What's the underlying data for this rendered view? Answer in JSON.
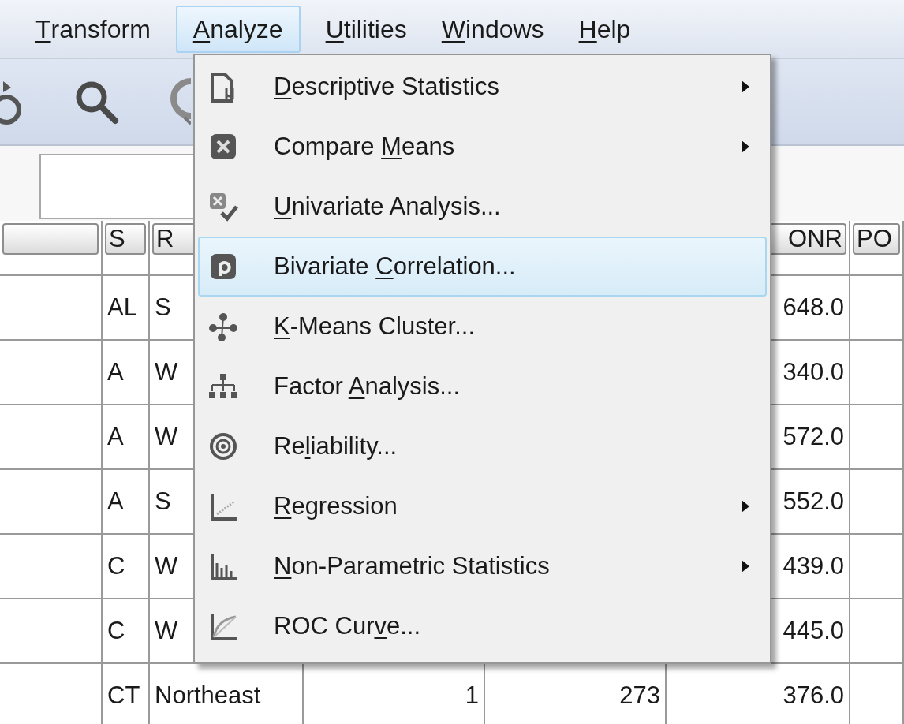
{
  "menu_bar": [
    {
      "key": "T",
      "post": "ransform",
      "selected": false
    },
    {
      "key": "A",
      "post": "nalyze",
      "selected": true
    },
    {
      "key": "U",
      "post": "tilities",
      "selected": false
    },
    {
      "key": "W",
      "post": "indows",
      "selected": false
    },
    {
      "key": "H",
      "post": "elp",
      "selected": false
    }
  ],
  "table": {
    "headers": {
      "column_2": "S",
      "column_3": "R",
      "column_6": "ONR",
      "column_7": "PO"
    },
    "rows": [
      {
        "column_2": "AL",
        "column_3": "S",
        "column_6": "648.0"
      },
      {
        "column_2": "A",
        "column_3": "W",
        "column_6": "340.0"
      },
      {
        "column_2": "A",
        "column_3": "W",
        "column_6": "572.0"
      },
      {
        "column_2": "A",
        "column_3": "S",
        "column_6": "552.0"
      },
      {
        "column_2": "C",
        "column_3": "W",
        "column_6": "439.0"
      },
      {
        "column_2": "C",
        "column_3": "W",
        "column_6": "445.0"
      },
      {
        "column_2": "CT",
        "column_3": "Northeast",
        "column_4": "1",
        "column_5": "273",
        "column_6": "376.0"
      }
    ]
  },
  "menu": {
    "items": [
      {
        "kind": "descriptive",
        "key": "D",
        "post": "escriptive Statistics",
        "submenu": true,
        "selected": false
      },
      {
        "kind": "means",
        "pre": "Compare ",
        "key": "M",
        "post": "eans",
        "submenu": true,
        "selected": false
      },
      {
        "kind": "univariate",
        "key": "U",
        "post": "nivariate Analysis...",
        "submenu": false,
        "selected": false
      },
      {
        "kind": "correlation",
        "pre": "Bivariate ",
        "key": "C",
        "post": "orrelation...",
        "submenu": false,
        "selected": true
      },
      {
        "kind": "cluster",
        "key": "K",
        "post": "-Means Cluster...",
        "submenu": false,
        "selected": false
      },
      {
        "kind": "factor",
        "pre": "Factor ",
        "key": "A",
        "post": "nalysis...",
        "submenu": false,
        "selected": false
      },
      {
        "kind": "reliability",
        "pre": "Re",
        "key": "l",
        "post": "iability...",
        "submenu": false,
        "selected": false
      },
      {
        "kind": "regression",
        "key": "R",
        "post": "egression",
        "submenu": true,
        "selected": false
      },
      {
        "kind": "nonparametric",
        "key": "N",
        "post": "on-Parametric Statistics",
        "submenu": true,
        "selected": false
      },
      {
        "kind": "roc",
        "pre": "ROC Cur",
        "key": "v",
        "post": "e...",
        "submenu": false,
        "selected": false
      }
    ]
  }
}
